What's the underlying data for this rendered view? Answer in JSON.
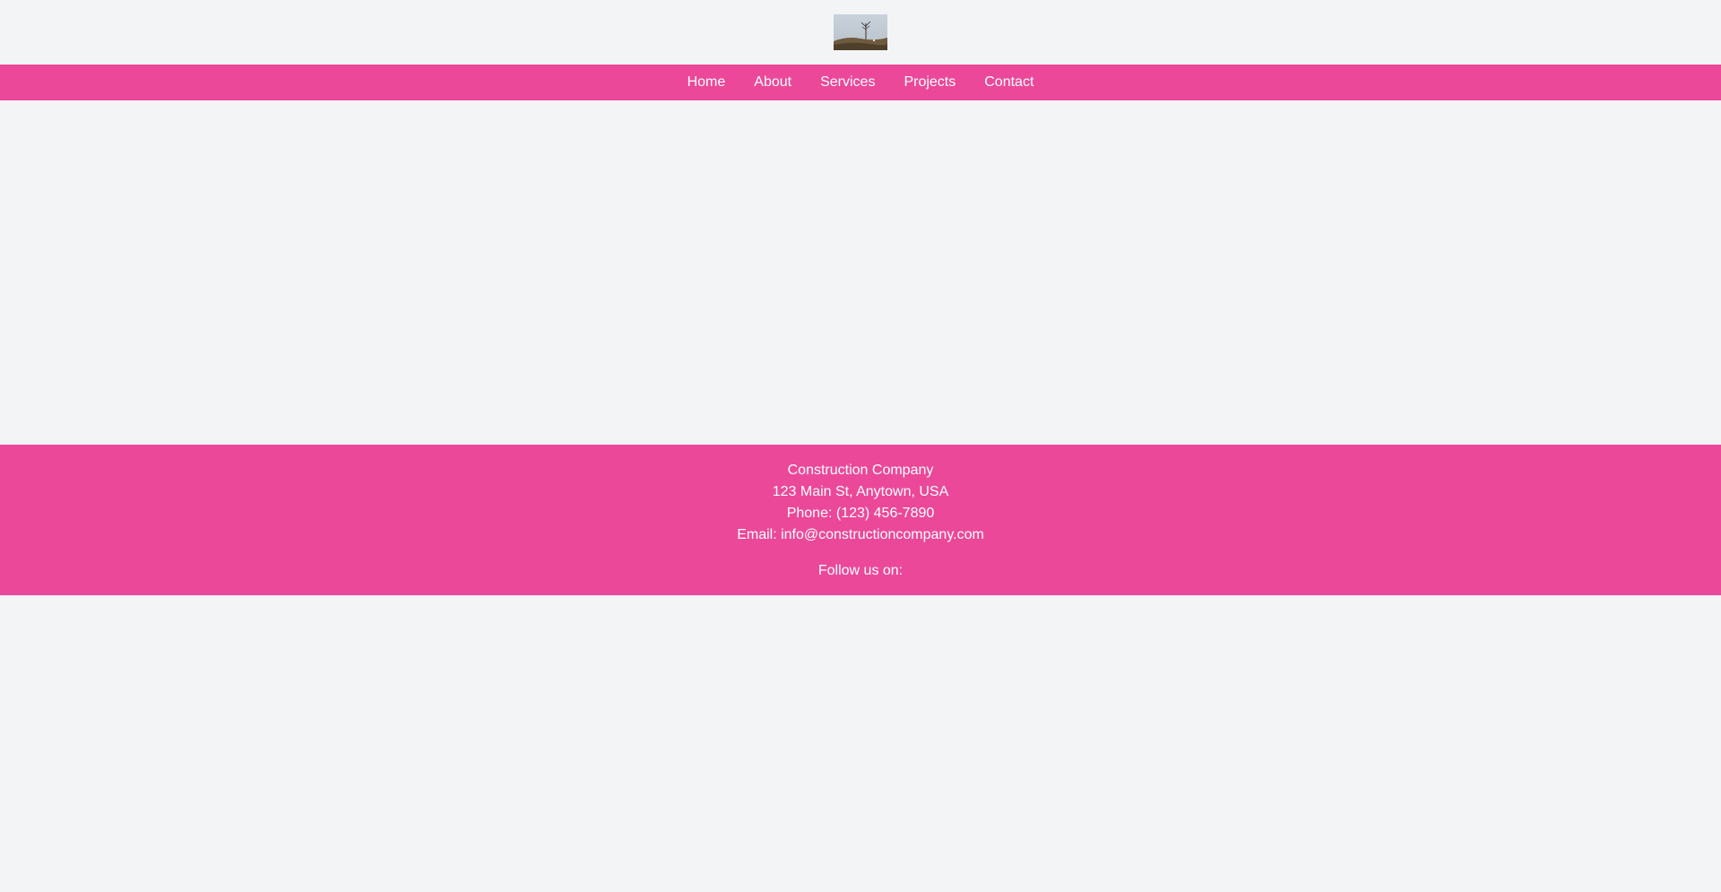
{
  "header": {
    "logo_alt": "Construction Company logo"
  },
  "nav": {
    "items": [
      {
        "label": "Home"
      },
      {
        "label": "About"
      },
      {
        "label": "Services"
      },
      {
        "label": "Projects"
      },
      {
        "label": "Contact"
      }
    ]
  },
  "footer": {
    "company": "Construction Company",
    "address": "123 Main St, Anytown, USA",
    "phone": "Phone: (123) 456-7890",
    "email": "Email: info@constructioncompany.com",
    "follow": "Follow us on:"
  },
  "colors": {
    "brand_pink": "#ec4899",
    "page_background": "#f3f4f6",
    "text_on_brand": "#ffffff"
  }
}
